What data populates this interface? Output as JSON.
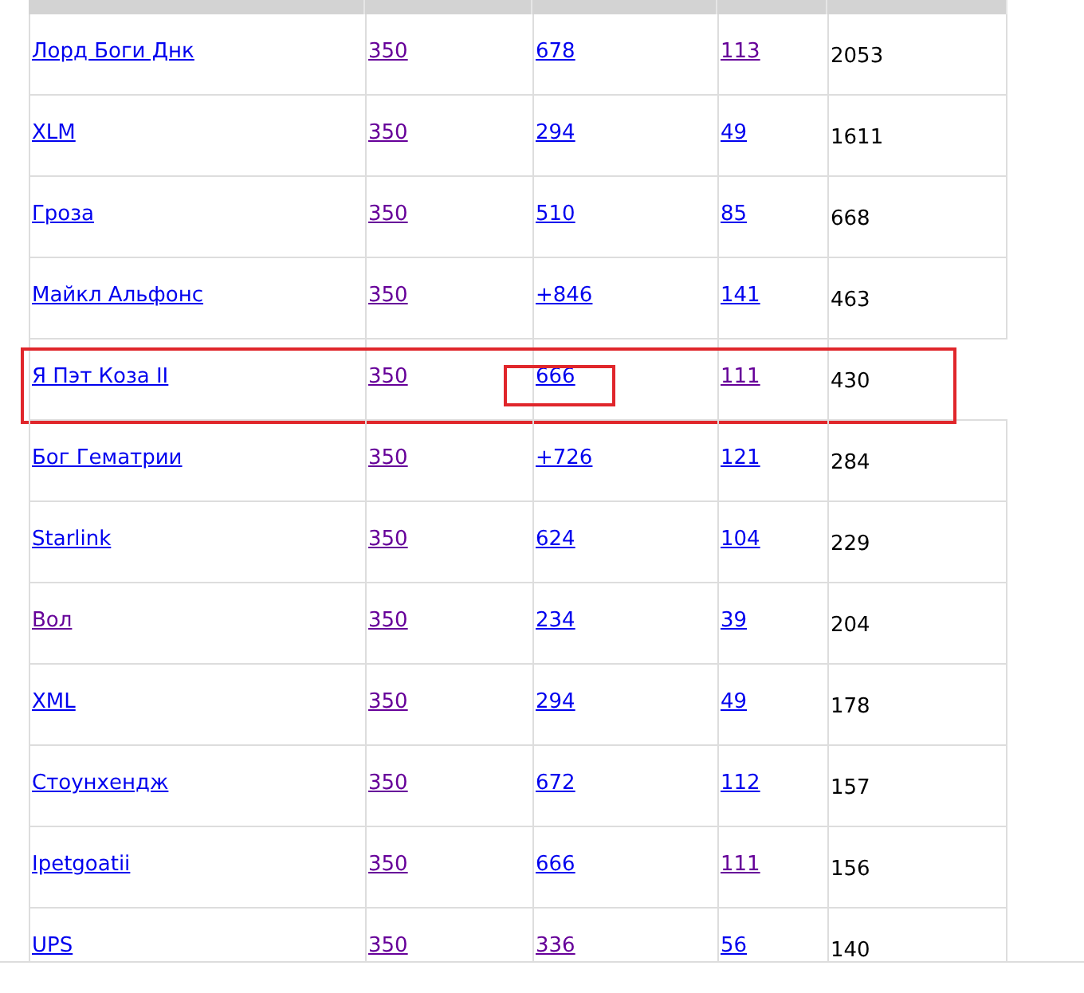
{
  "rows": [
    {
      "highlighted": false,
      "cells": [
        {
          "text": "Лорд Боги Днк",
          "visited": false,
          "highlighted": false
        },
        {
          "text": "350",
          "visited": true,
          "highlighted": false
        },
        {
          "text": "678",
          "visited": false,
          "highlighted": false
        },
        {
          "text": "113",
          "visited": true,
          "highlighted": false
        }
      ],
      "total": "2053"
    },
    {
      "highlighted": false,
      "cells": [
        {
          "text": "XLM",
          "visited": false,
          "highlighted": false
        },
        {
          "text": "350",
          "visited": true,
          "highlighted": false
        },
        {
          "text": "294",
          "visited": false,
          "highlighted": false
        },
        {
          "text": "49",
          "visited": false,
          "highlighted": false
        }
      ],
      "total": "1611"
    },
    {
      "highlighted": false,
      "cells": [
        {
          "text": "Гроза",
          "visited": false,
          "highlighted": false
        },
        {
          "text": "350",
          "visited": true,
          "highlighted": false
        },
        {
          "text": "510",
          "visited": false,
          "highlighted": false
        },
        {
          "text": "85",
          "visited": false,
          "highlighted": false
        }
      ],
      "total": "668"
    },
    {
      "highlighted": false,
      "cells": [
        {
          "text": "Майкл Альфонс",
          "visited": false,
          "highlighted": false
        },
        {
          "text": "350",
          "visited": true,
          "highlighted": false
        },
        {
          "text": "+846",
          "visited": false,
          "highlighted": false
        },
        {
          "text": "141",
          "visited": false,
          "highlighted": false
        }
      ],
      "total": "463"
    },
    {
      "highlighted": true,
      "cells": [
        {
          "text": "Я Пэт Коза II",
          "visited": false,
          "highlighted": false
        },
        {
          "text": "350",
          "visited": true,
          "highlighted": false
        },
        {
          "text": "666",
          "visited": false,
          "highlighted": true
        },
        {
          "text": "111",
          "visited": true,
          "highlighted": false
        }
      ],
      "total": "430"
    },
    {
      "highlighted": false,
      "cells": [
        {
          "text": "Бог Гематрии",
          "visited": false,
          "highlighted": false
        },
        {
          "text": "350",
          "visited": true,
          "highlighted": false
        },
        {
          "text": "+726",
          "visited": false,
          "highlighted": false
        },
        {
          "text": "121",
          "visited": false,
          "highlighted": false
        }
      ],
      "total": "284"
    },
    {
      "highlighted": false,
      "cells": [
        {
          "text": "Starlink",
          "visited": false,
          "highlighted": false
        },
        {
          "text": "350",
          "visited": true,
          "highlighted": false
        },
        {
          "text": "624",
          "visited": false,
          "highlighted": false
        },
        {
          "text": "104",
          "visited": false,
          "highlighted": false
        }
      ],
      "total": "229"
    },
    {
      "highlighted": false,
      "cells": [
        {
          "text": "Вол",
          "visited": true,
          "highlighted": false
        },
        {
          "text": "350",
          "visited": true,
          "highlighted": false
        },
        {
          "text": "234",
          "visited": false,
          "highlighted": false
        },
        {
          "text": "39",
          "visited": false,
          "highlighted": false
        }
      ],
      "total": "204"
    },
    {
      "highlighted": false,
      "cells": [
        {
          "text": "XML",
          "visited": false,
          "highlighted": false
        },
        {
          "text": "350",
          "visited": true,
          "highlighted": false
        },
        {
          "text": "294",
          "visited": false,
          "highlighted": false
        },
        {
          "text": "49",
          "visited": false,
          "highlighted": false
        }
      ],
      "total": "178"
    },
    {
      "highlighted": false,
      "cells": [
        {
          "text": "Стоунхендж",
          "visited": false,
          "highlighted": false
        },
        {
          "text": "350",
          "visited": true,
          "highlighted": false
        },
        {
          "text": "672",
          "visited": false,
          "highlighted": false
        },
        {
          "text": "112",
          "visited": false,
          "highlighted": false
        }
      ],
      "total": "157"
    },
    {
      "highlighted": false,
      "cells": [
        {
          "text": "Ipetgoatii",
          "visited": false,
          "highlighted": false
        },
        {
          "text": "350",
          "visited": true,
          "highlighted": false
        },
        {
          "text": "666",
          "visited": false,
          "highlighted": false
        },
        {
          "text": "111",
          "visited": true,
          "highlighted": false
        }
      ],
      "total": "156"
    },
    {
      "highlighted": false,
      "cells": [
        {
          "text": "UPS",
          "visited": false,
          "highlighted": false
        },
        {
          "text": "350",
          "visited": true,
          "highlighted": false
        },
        {
          "text": "336",
          "visited": true,
          "highlighted": false
        },
        {
          "text": "56",
          "visited": false,
          "highlighted": false
        }
      ],
      "total": "140"
    }
  ]
}
